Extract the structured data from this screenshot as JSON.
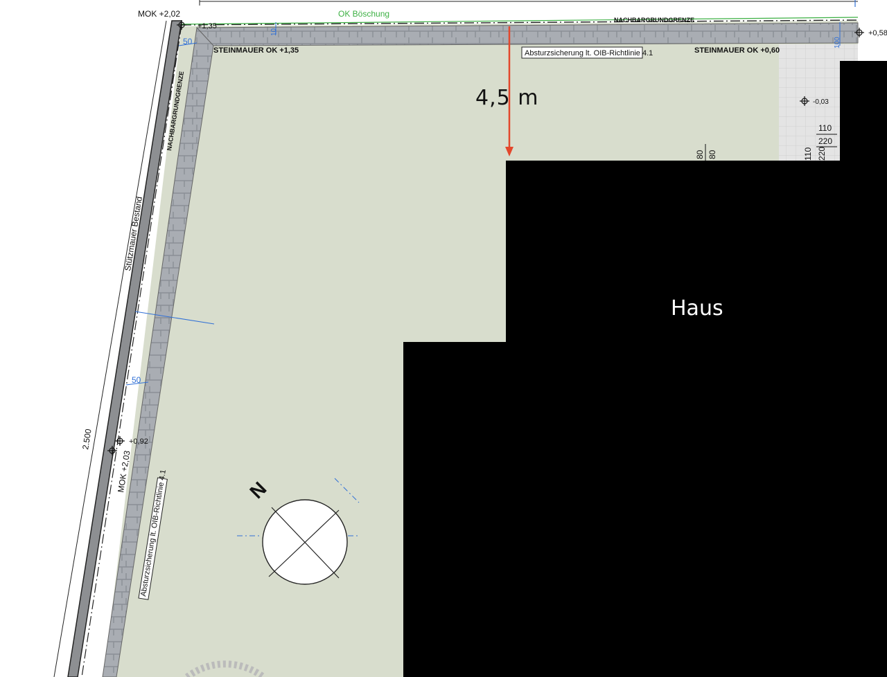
{
  "colors": {
    "lawn": "#d8ddcd",
    "wall_stone": "#a9adb3",
    "wall_stone_dark": "#8a8f96",
    "boundary_line": "#222222",
    "green_line": "#3cb043",
    "blue_dim": "#2f6fd6",
    "arrow_red": "#e3472b",
    "house": "#000000",
    "paving": "#e4e4e4"
  },
  "labels": {
    "mok_top": "MOK +2,02",
    "ok_boeschung": "OK Böschung",
    "nachbargrundgrenze_top": "NACHBARGRUNDGRENZE",
    "nachbargrundgrenze_side": "NACHBARGRUNDGRENZE",
    "steinmauer_left": "STEINMAUER OK +1,35",
    "steinmauer_right": "STEINMAUER OK +0,60",
    "absturz_top": "Absturzsicherung lt. OIB-Richtlinie 4.1",
    "absturz_side": "Absturzsicherung lt. OIB-Richtlinie 4.1",
    "stuetzmauer": "Stützmauer Bestand",
    "dim_2500": "2.500",
    "mok_side": "MOK +2,03",
    "house": "Haus",
    "measure": "4,5 m",
    "north": "N"
  },
  "levels": {
    "plus_135": "+1,35",
    "plus_058": "+0,58",
    "minus_003": "-0,03",
    "plus_092": "+0,92"
  },
  "dimensions": {
    "d50_top": "50",
    "d50_side": "50",
    "d10": "10",
    "d100": "100",
    "d80a": "80",
    "d80b": "80",
    "d110a": "110",
    "d220a": "220",
    "d110b": "110",
    "d220b": "220"
  }
}
